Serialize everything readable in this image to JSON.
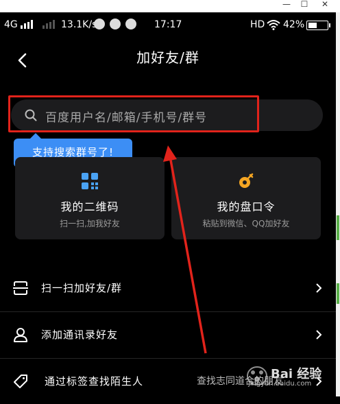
{
  "status_bar": {
    "network": "4G",
    "speed": "13.1K/s",
    "time": "17:17",
    "hd": "HD",
    "battery": "42%"
  },
  "header": {
    "title": "加好友/群",
    "back_icon": "back-arrow-icon"
  },
  "search": {
    "placeholder": "百度用户名/邮箱/手机号/群号",
    "icon": "search-icon"
  },
  "tooltip": {
    "text": "支持搜索群号了!"
  },
  "cards": [
    {
      "icon": "qr-code-icon",
      "title": "我的二维码",
      "subtitle": "扫一扫,加我好友"
    },
    {
      "icon": "key-icon",
      "title": "我的盘口令",
      "subtitle": "粘贴到微信、QQ加好友"
    }
  ],
  "rows": [
    {
      "icon": "scan-icon",
      "label": "扫一扫加好友/群"
    },
    {
      "icon": "contact-icon",
      "label": "添加通讯录好友"
    },
    {
      "icon": "tag-icon",
      "label": "通过标签查找陌生人",
      "right_text": "查找志同道合的朋友"
    }
  ],
  "watermark": {
    "logo_text": "Bai 经验",
    "url": "jingyan.baidu.com"
  },
  "colors": {
    "background": "#000000",
    "card": "#1c1c1e",
    "tooltip": "#3c8ef5",
    "annotation": "#e1231b"
  }
}
